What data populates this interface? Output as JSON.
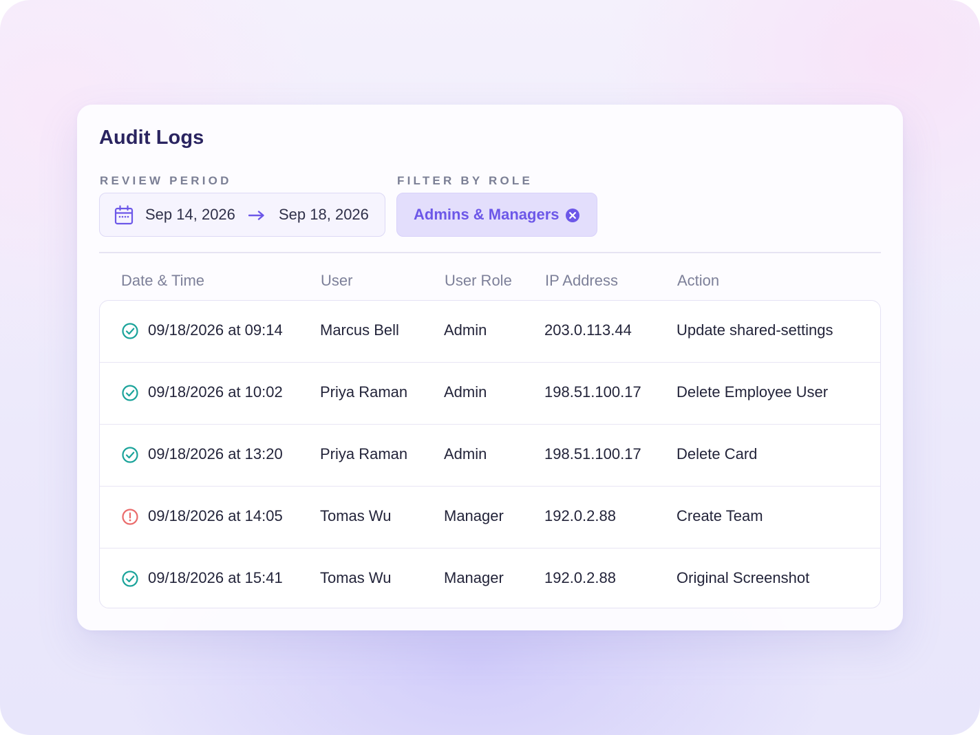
{
  "title": "Audit Logs",
  "filters": {
    "period_label": "REVIEW PERIOD",
    "start_date": "Sep 14, 2026",
    "end_date": "Sep 18, 2026",
    "role_label": "FILTER BY ROLE",
    "role_chip": "Admins & Managers"
  },
  "table": {
    "headers": [
      "Date & Time",
      "User",
      "User Role",
      "IP Address",
      "Action"
    ],
    "rows": [
      {
        "status": "success",
        "datetime": "09/18/2026 at 09:14",
        "user": "Marcus Bell",
        "role": "Admin",
        "ip": "203.0.113.44",
        "action": "Update shared-settings"
      },
      {
        "status": "success",
        "datetime": "09/18/2026 at 10:02",
        "user": "Priya Raman",
        "role": "Admin",
        "ip": "198.51.100.17",
        "action": "Delete Employee User"
      },
      {
        "status": "success",
        "datetime": "09/18/2026 at 13:20",
        "user": "Priya Raman",
        "role": "Admin",
        "ip": "198.51.100.17",
        "action": "Delete Card"
      },
      {
        "status": "error",
        "datetime": "09/18/2026 at 14:05",
        "user": "Tomas Wu",
        "role": "Manager",
        "ip": "192.0.2.88",
        "action": "Create Team"
      },
      {
        "status": "success",
        "datetime": "09/18/2026 at 15:41",
        "user": "Tomas Wu",
        "role": "Manager",
        "ip": "192.0.2.88",
        "action": "Original Screenshot"
      }
    ]
  },
  "icons": {
    "calendar": "calendar-icon",
    "arrow": "arrow-right-icon",
    "remove": "close-circle-icon",
    "success": "check-circle-icon",
    "error": "alert-circle-icon"
  },
  "colors": {
    "accent": "#6c57e8",
    "success": "#1aa39a",
    "error": "#ea6b6b",
    "title": "#2a2460"
  }
}
